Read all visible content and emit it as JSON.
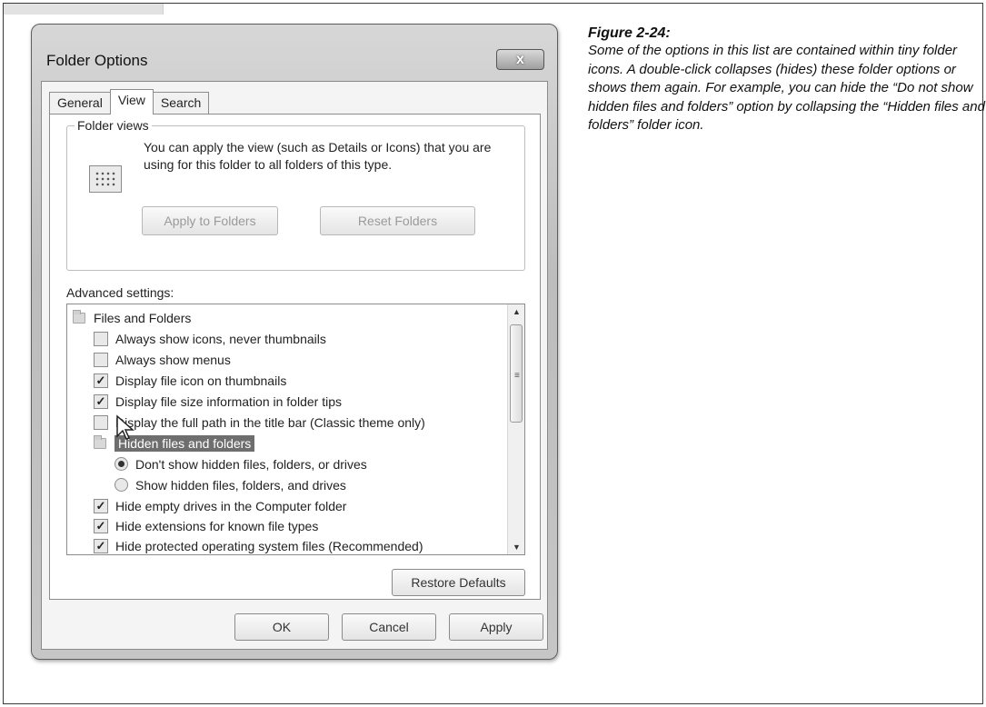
{
  "window": {
    "title": "Folder Options",
    "close_label": "x"
  },
  "tabs": [
    "General",
    "View",
    "Search"
  ],
  "folder_views": {
    "label": "Folder views",
    "description": "You can apply the view (such as Details or Icons) that you are using for this folder to all folders of this type.",
    "apply_button": "Apply to Folders",
    "reset_button": "Reset Folders"
  },
  "advanced": {
    "label": "Advanced settings:",
    "items": [
      {
        "type": "folder",
        "label": "Files and Folders"
      },
      {
        "type": "checkbox",
        "checked": false,
        "label": "Always show icons, never thumbnails"
      },
      {
        "type": "checkbox",
        "checked": false,
        "label": "Always show menus"
      },
      {
        "type": "checkbox",
        "checked": true,
        "label": "Display file icon on thumbnails"
      },
      {
        "type": "checkbox",
        "checked": true,
        "label": "Display file size information in folder tips"
      },
      {
        "type": "checkbox",
        "checked": false,
        "label": "Display the full path in the title bar (Classic theme only)"
      },
      {
        "type": "folder",
        "label": "Hidden files and folders",
        "selected": true
      },
      {
        "type": "radio",
        "checked": true,
        "label": "Don't show hidden files, folders, or drives"
      },
      {
        "type": "radio",
        "checked": false,
        "label": "Show hidden files, folders, and drives"
      },
      {
        "type": "checkbox",
        "checked": true,
        "label": "Hide empty drives in the Computer folder"
      },
      {
        "type": "checkbox",
        "checked": true,
        "label": "Hide extensions for known file types"
      },
      {
        "type": "checkbox",
        "checked": true,
        "label": "Hide protected operating system files (Recommended)"
      }
    ],
    "restore_button": "Restore Defaults"
  },
  "footer": {
    "ok": "OK",
    "cancel": "Cancel",
    "apply": "Apply"
  },
  "caption": {
    "title": "Figure 2-24:",
    "body": "Some of the options in this list are contained within tiny folder icons. A double-click collapses (hides) these folder options or shows them again. For example, you can hide the “Do not show hidden files and folders” option by collapsing the “Hidden files and folders” folder icon."
  },
  "colors": {
    "selection": "#6e6e6e",
    "window_frame": "#bdbdbd"
  }
}
